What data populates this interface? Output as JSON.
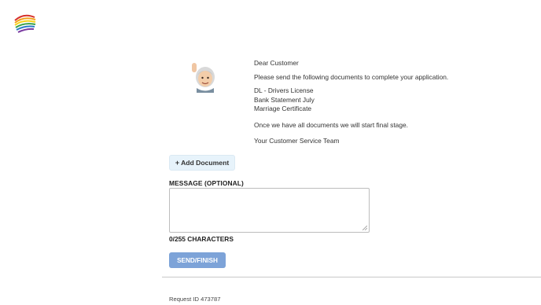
{
  "logo": {
    "icon": "rainbow-swoosh-logo",
    "colors": [
      "#d6322c",
      "#f2a21b",
      "#f6d21a",
      "#3aa14a",
      "#2a7cc7",
      "#7a3aa0"
    ]
  },
  "avatar": {
    "icon": "waving-memoji-avatar"
  },
  "letter": {
    "greeting": "Dear Customer",
    "intro": "Please send the following documents to complete your application.",
    "documents": [
      "DL - Drivers License",
      "Bank Statement July",
      "Marriage Certificate"
    ],
    "closing": "Once we have all documents we will start final stage.",
    "signature": "Your Customer Service Team"
  },
  "add_document": {
    "icon": "plus-icon",
    "label": "Add Document"
  },
  "message": {
    "label": "MESSAGE (OPTIONAL)",
    "value": "",
    "char_count": "0/255 CHARACTERS"
  },
  "send_button": {
    "label": "SEND/FINISH",
    "color": "#7da3d8"
  },
  "footer": {
    "request_id": "Request ID 473787"
  }
}
